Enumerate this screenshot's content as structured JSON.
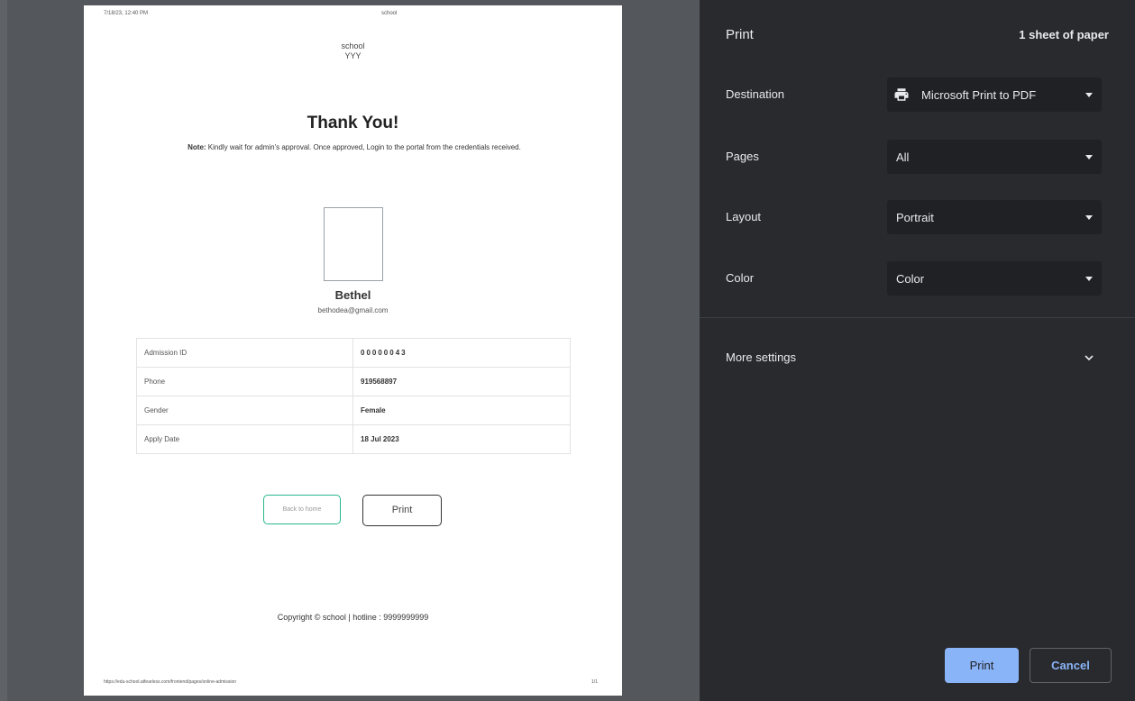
{
  "preview": {
    "header_date": "7/18/23, 12:40 PM",
    "header_title": "school",
    "school_name": "school",
    "school_sub": "YYY",
    "thanks": "Thank You!",
    "note_label": "Note:",
    "note_text": " Kindly wait for admin's approval. Once approved, Login to the portal from the credentials received.",
    "student_name": "Bethel",
    "student_email": "bethodea@gmail.com",
    "info_rows": [
      {
        "label": "Admission ID",
        "value": "00000043"
      },
      {
        "label": "Phone",
        "value": "919568897"
      },
      {
        "label": "Gender",
        "value": "Female"
      },
      {
        "label": "Apply Date",
        "value": "18 Jul 2023"
      }
    ],
    "back_home_label": "Back to home",
    "print_label": "Print",
    "copyright": "Copyright © school | hotline : 9999999999",
    "footer_url": "https://edu-school.atfearless.com/frontend/pages/online-admission",
    "footer_page": "1/1"
  },
  "panel": {
    "title": "Print",
    "sheets": "1 sheet of paper",
    "destination_label": "Destination",
    "destination_value": "Microsoft Print to PDF",
    "pages_label": "Pages",
    "pages_value": "All",
    "layout_label": "Layout",
    "layout_value": "Portrait",
    "color_label": "Color",
    "color_value": "Color",
    "more_settings_label": "More settings",
    "print_button": "Print",
    "cancel_button": "Cancel"
  },
  "colors": {
    "panel_bg": "#292a2d",
    "dropdown_bg": "#202124",
    "accent": "#8ab4f8",
    "home_button_border": "#28b78d"
  },
  "icons": {
    "destination": "printer-icon",
    "more_settings": "chevron-down-icon",
    "dropdowns": "caret-down-icon"
  }
}
